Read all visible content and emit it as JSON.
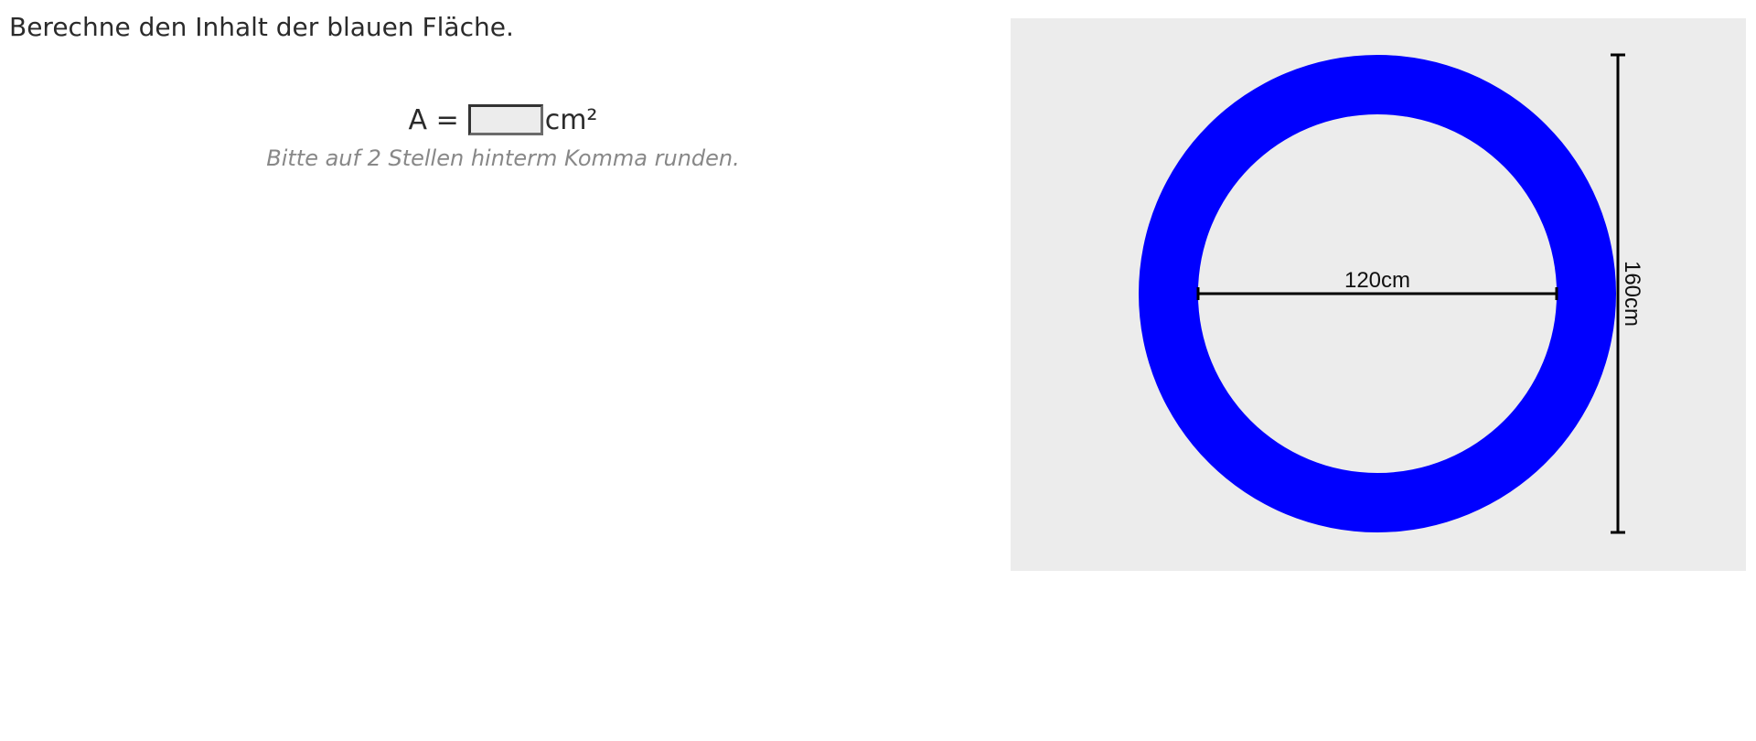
{
  "task": {
    "title": "Berechne den Inhalt der blauen Fläche."
  },
  "answer": {
    "label": "A =",
    "value": "",
    "unit": "cm²",
    "hint": "Bitte auf 2 Stellen hinterm Komma runden."
  },
  "figure": {
    "inner_diameter_label": "120cm",
    "outer_diameter_label": "160cm",
    "ring_color": "#0000ff",
    "background_color": "#ececec"
  }
}
